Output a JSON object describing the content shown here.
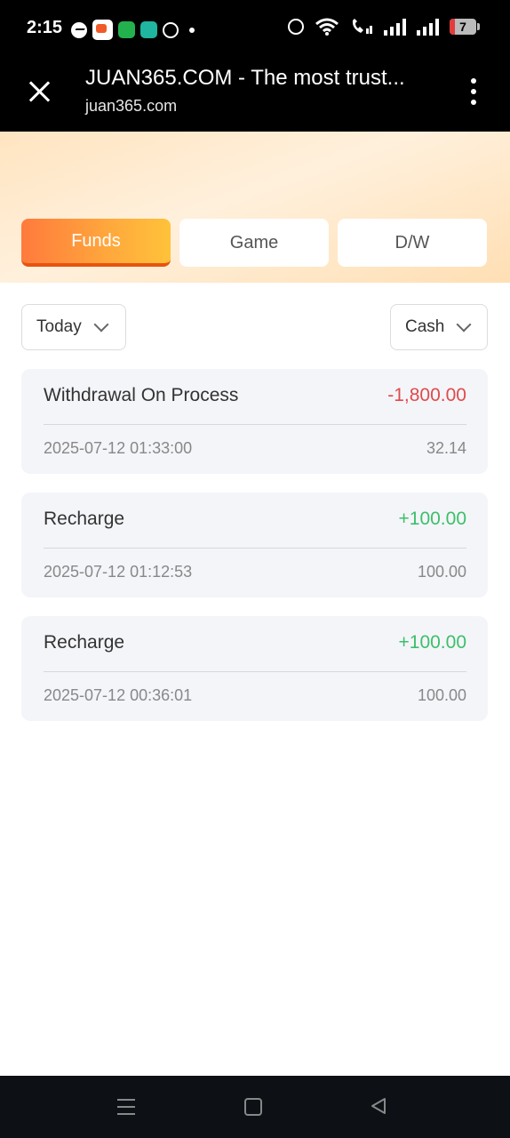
{
  "status_bar": {
    "time": "2:15",
    "battery": "7"
  },
  "browser": {
    "title": "JUAN365.COM - The most trust...",
    "url": "juan365.com"
  },
  "tabs": [
    {
      "label": "Funds",
      "active": true
    },
    {
      "label": "Game",
      "active": false
    },
    {
      "label": "D/W",
      "active": false
    }
  ],
  "filters": {
    "date": "Today",
    "type": "Cash"
  },
  "records": [
    {
      "type": "Withdrawal On Process",
      "amount": "-1,800.00",
      "time": "2025-07-12 01:33:00",
      "balance": "32.14"
    },
    {
      "type": "Recharge",
      "amount": "+100.00",
      "time": "2025-07-12 01:12:53",
      "balance": "100.00"
    },
    {
      "type": "Recharge",
      "amount": "+100.00",
      "time": "2025-07-12 00:36:01",
      "balance": "100.00"
    }
  ],
  "colors": {
    "accent": "#ff8a3c",
    "negative": "#e04a4a",
    "positive": "#3cbf6a"
  }
}
